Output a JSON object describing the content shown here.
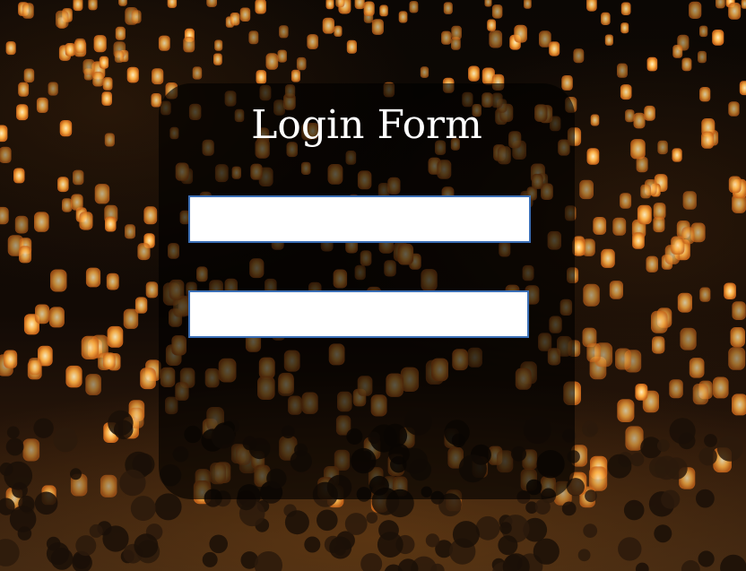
{
  "form": {
    "title": "Login Form",
    "username": {
      "value": "",
      "placeholder": ""
    },
    "password": {
      "value": "",
      "placeholder": ""
    }
  },
  "colors": {
    "panel": "#000000",
    "field_border": "#3b6fb6",
    "title": "#ffffff",
    "lantern_glow": "#ffb347"
  }
}
